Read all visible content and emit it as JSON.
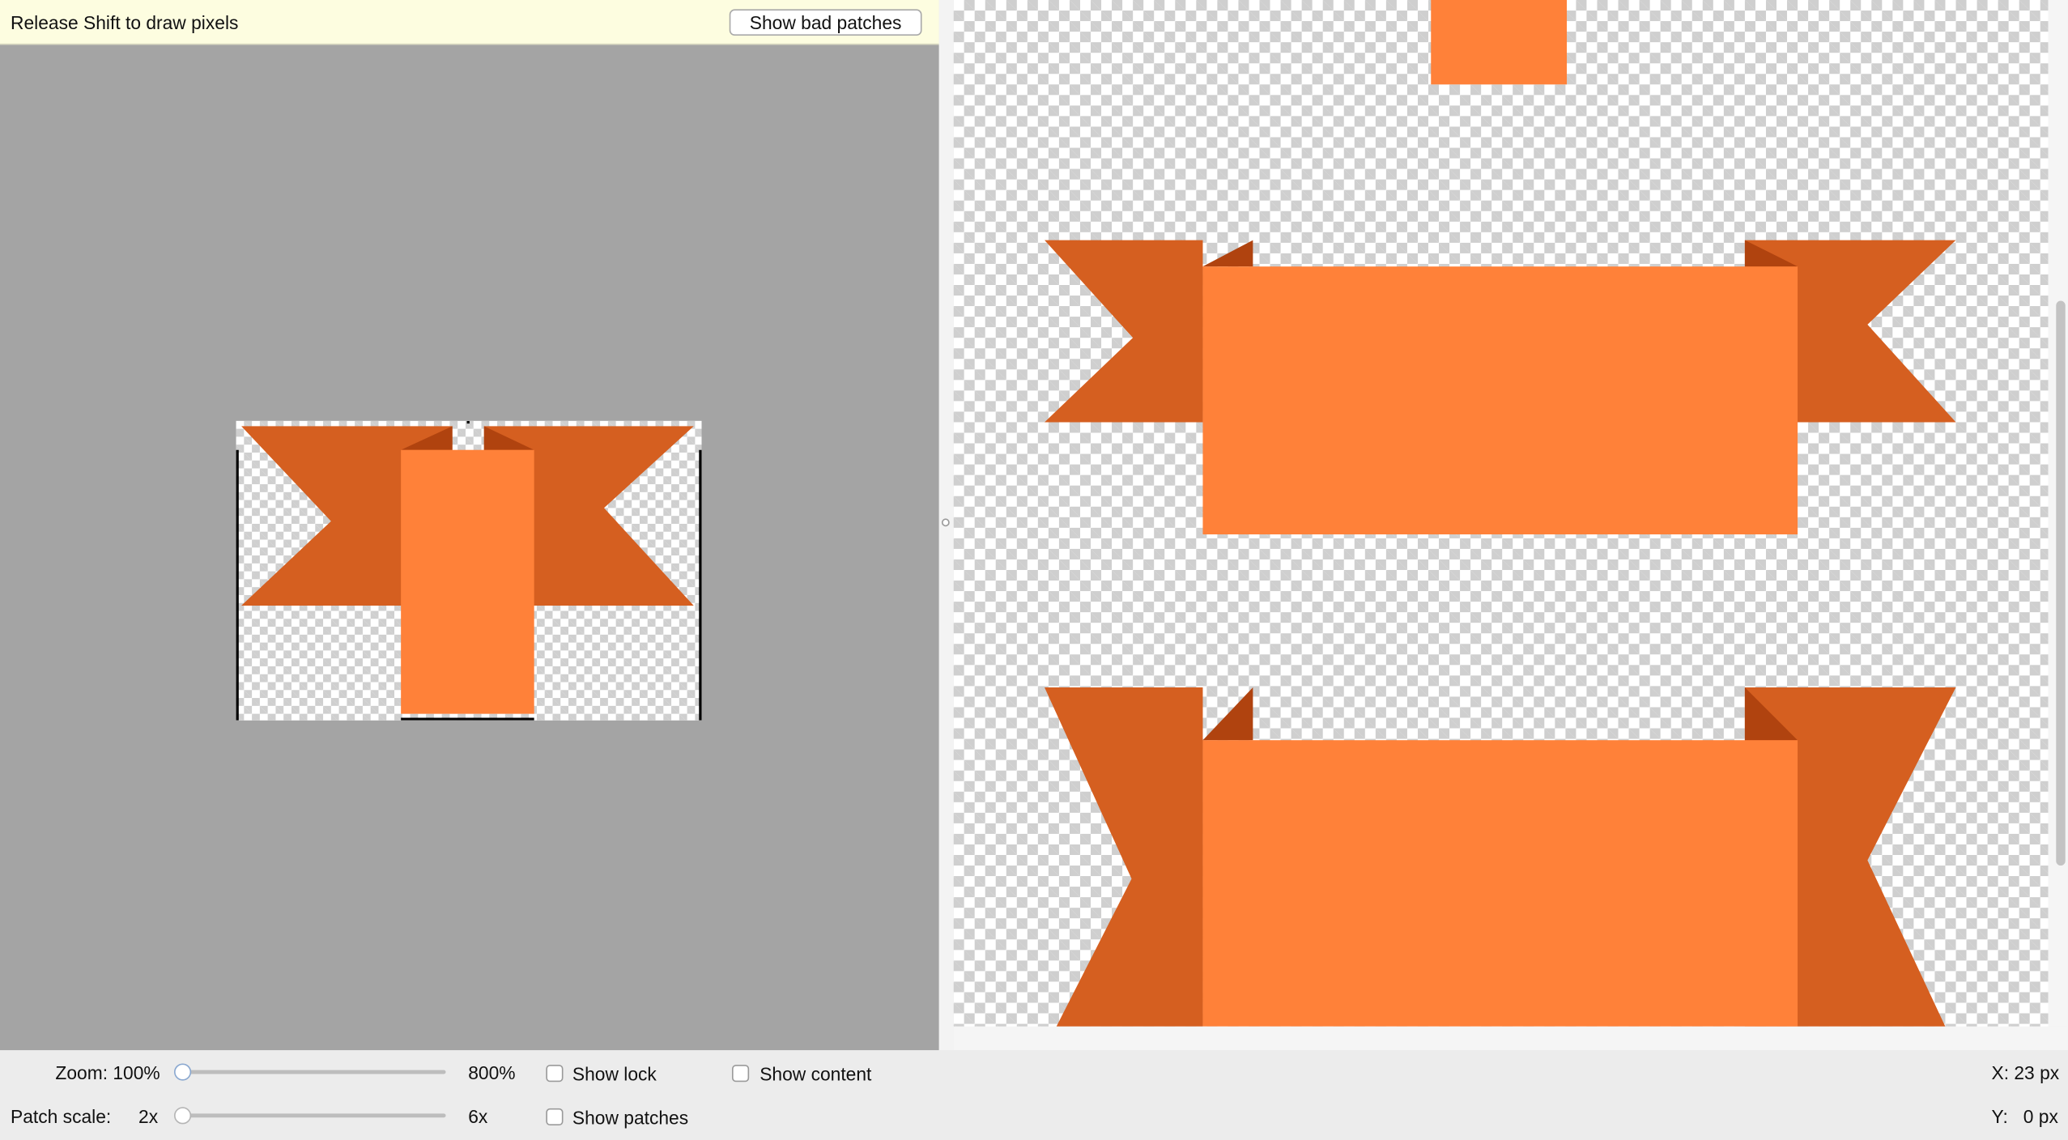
{
  "editor": {
    "hint": "Release Shift to draw pixels",
    "bad_patches_label": "Show bad patches"
  },
  "controls": {
    "zoom_label": "Zoom: 100%",
    "zoom_max": "800%",
    "zoom_value": 0,
    "patch_scale_label": "Patch scale:",
    "patch_scale_min": "2x",
    "patch_scale_max": "6x",
    "patch_scale_value": 0,
    "show_lock": "Show lock",
    "show_content": "Show content",
    "show_patches": "Show patches",
    "show_lock_checked": false,
    "show_content_checked": false,
    "show_patches_checked": false
  },
  "status": {
    "x": "X: 23 px",
    "y": "Y:   0 px"
  },
  "colors": {
    "ribbon_light": "#ff8139",
    "ribbon_dark": "#d55f20",
    "ribbon_fold": "#b0430f",
    "canvas_bg": "#a4a4a4",
    "hint_bar": "#fdfde0"
  }
}
